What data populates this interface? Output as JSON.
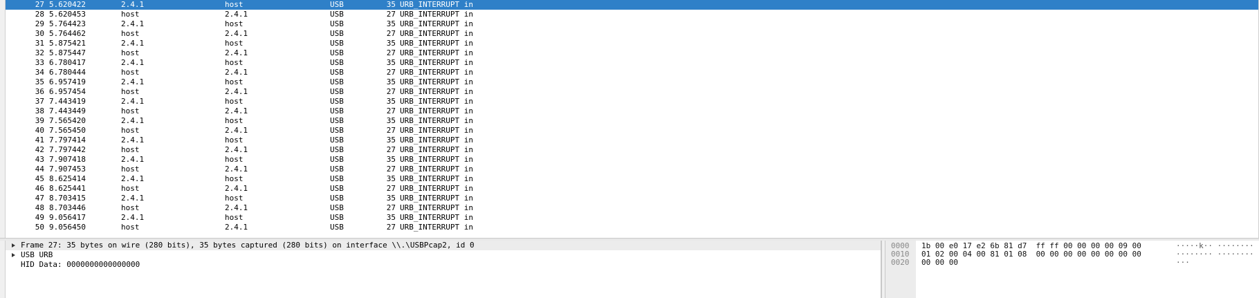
{
  "packets": [
    {
      "no": "27",
      "time": "5.620422",
      "src": "2.4.1",
      "dst": "host",
      "proto": "USB",
      "len": "35",
      "info": "URB_INTERRUPT in",
      "selected": true
    },
    {
      "no": "28",
      "time": "5.620453",
      "src": "host",
      "dst": "2.4.1",
      "proto": "USB",
      "len": "27",
      "info": "URB_INTERRUPT in"
    },
    {
      "no": "29",
      "time": "5.764423",
      "src": "2.4.1",
      "dst": "host",
      "proto": "USB",
      "len": "35",
      "info": "URB_INTERRUPT in"
    },
    {
      "no": "30",
      "time": "5.764462",
      "src": "host",
      "dst": "2.4.1",
      "proto": "USB",
      "len": "27",
      "info": "URB_INTERRUPT in"
    },
    {
      "no": "31",
      "time": "5.875421",
      "src": "2.4.1",
      "dst": "host",
      "proto": "USB",
      "len": "35",
      "info": "URB_INTERRUPT in"
    },
    {
      "no": "32",
      "time": "5.875447",
      "src": "host",
      "dst": "2.4.1",
      "proto": "USB",
      "len": "27",
      "info": "URB_INTERRUPT in"
    },
    {
      "no": "33",
      "time": "6.780417",
      "src": "2.4.1",
      "dst": "host",
      "proto": "USB",
      "len": "35",
      "info": "URB_INTERRUPT in"
    },
    {
      "no": "34",
      "time": "6.780444",
      "src": "host",
      "dst": "2.4.1",
      "proto": "USB",
      "len": "27",
      "info": "URB_INTERRUPT in"
    },
    {
      "no": "35",
      "time": "6.957419",
      "src": "2.4.1",
      "dst": "host",
      "proto": "USB",
      "len": "35",
      "info": "URB_INTERRUPT in"
    },
    {
      "no": "36",
      "time": "6.957454",
      "src": "host",
      "dst": "2.4.1",
      "proto": "USB",
      "len": "27",
      "info": "URB_INTERRUPT in"
    },
    {
      "no": "37",
      "time": "7.443419",
      "src": "2.4.1",
      "dst": "host",
      "proto": "USB",
      "len": "35",
      "info": "URB_INTERRUPT in"
    },
    {
      "no": "38",
      "time": "7.443449",
      "src": "host",
      "dst": "2.4.1",
      "proto": "USB",
      "len": "27",
      "info": "URB_INTERRUPT in"
    },
    {
      "no": "39",
      "time": "7.565420",
      "src": "2.4.1",
      "dst": "host",
      "proto": "USB",
      "len": "35",
      "info": "URB_INTERRUPT in"
    },
    {
      "no": "40",
      "time": "7.565450",
      "src": "host",
      "dst": "2.4.1",
      "proto": "USB",
      "len": "27",
      "info": "URB_INTERRUPT in"
    },
    {
      "no": "41",
      "time": "7.797414",
      "src": "2.4.1",
      "dst": "host",
      "proto": "USB",
      "len": "35",
      "info": "URB_INTERRUPT in"
    },
    {
      "no": "42",
      "time": "7.797442",
      "src": "host",
      "dst": "2.4.1",
      "proto": "USB",
      "len": "27",
      "info": "URB_INTERRUPT in"
    },
    {
      "no": "43",
      "time": "7.907418",
      "src": "2.4.1",
      "dst": "host",
      "proto": "USB",
      "len": "35",
      "info": "URB_INTERRUPT in"
    },
    {
      "no": "44",
      "time": "7.907453",
      "src": "host",
      "dst": "2.4.1",
      "proto": "USB",
      "len": "27",
      "info": "URB_INTERRUPT in"
    },
    {
      "no": "45",
      "time": "8.625414",
      "src": "2.4.1",
      "dst": "host",
      "proto": "USB",
      "len": "35",
      "info": "URB_INTERRUPT in"
    },
    {
      "no": "46",
      "time": "8.625441",
      "src": "host",
      "dst": "2.4.1",
      "proto": "USB",
      "len": "27",
      "info": "URB_INTERRUPT in"
    },
    {
      "no": "47",
      "time": "8.703415",
      "src": "2.4.1",
      "dst": "host",
      "proto": "USB",
      "len": "35",
      "info": "URB_INTERRUPT in"
    },
    {
      "no": "48",
      "time": "8.703446",
      "src": "host",
      "dst": "2.4.1",
      "proto": "USB",
      "len": "27",
      "info": "URB_INTERRUPT in"
    },
    {
      "no": "49",
      "time": "9.056417",
      "src": "2.4.1",
      "dst": "host",
      "proto": "USB",
      "len": "35",
      "info": "URB_INTERRUPT in"
    },
    {
      "no": "50",
      "time": "9.056450",
      "src": "host",
      "dst": "2.4.1",
      "proto": "USB",
      "len": "27",
      "info": "URB_INTERRUPT in"
    }
  ],
  "details": {
    "frame": "Frame 27: 35 bytes on wire (280 bits), 35 bytes captured (280 bits) on interface \\\\.\\USBPcap2, id 0",
    "usb_urb": "USB URB",
    "hid_data": "HID Data: 0000000000000000"
  },
  "hex": [
    {
      "offset": "0000",
      "bytes": "1b 00 e0 17 e2 6b 81 d7  ff ff 00 00 00 00 09 00",
      "ascii": "·····k·· ········"
    },
    {
      "offset": "0010",
      "bytes": "01 02 00 04 00 81 01 08  00 00 00 00 00 00 00 00",
      "ascii": "········ ········"
    },
    {
      "offset": "0020",
      "bytes": "00 00 00",
      "ascii": "···"
    }
  ],
  "colors": {
    "selected_row": "#2f80c8",
    "pane_bg": "#ececec"
  }
}
